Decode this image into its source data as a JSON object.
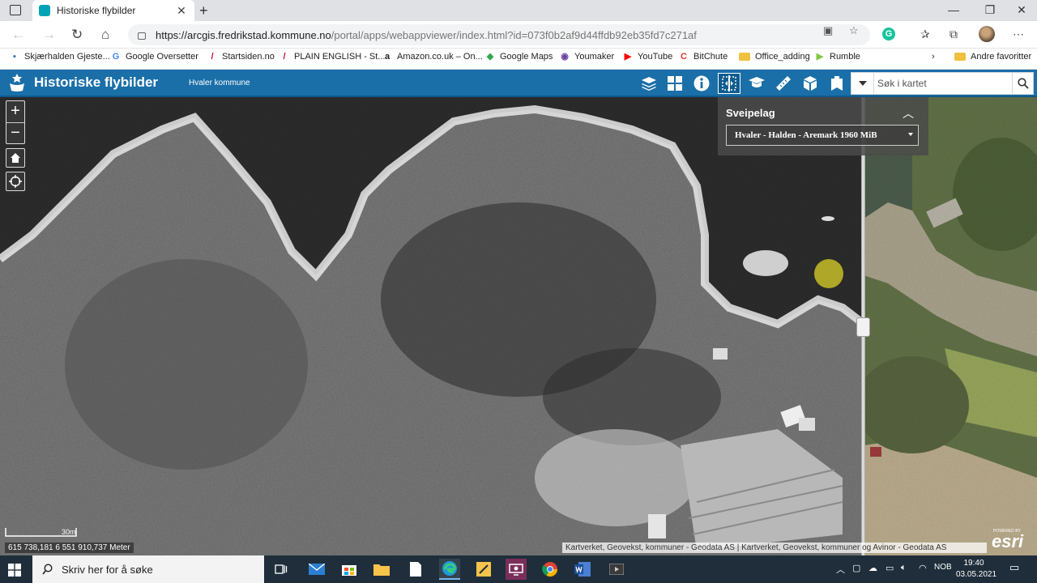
{
  "browser": {
    "tab_title": "Historiske flybilder",
    "url_host": "https://arcgis.fredrikstad.kommune.no",
    "url_path": "/portal/apps/webappviewer/index.html?id=073f0b2af9d44ffdb92eb35fd7c271af",
    "bookmarks": [
      {
        "label": "Skjærhalden Gjeste...",
        "icon": "bookmark-icon",
        "color": "#2a6db5"
      },
      {
        "label": "Google Oversetter",
        "icon": "translate-icon",
        "color": "#4285f4"
      },
      {
        "label": "Startsiden.no",
        "icon": "slash-icon",
        "color": "#c8102e"
      },
      {
        "label": "PLAIN ENGLISH - St...",
        "icon": "slash-icon",
        "color": "#c8102e"
      },
      {
        "label": "Amazon.co.uk – On...",
        "icon": "amazon-icon",
        "color": "#222222"
      },
      {
        "label": "Google Maps",
        "icon": "map-pin-icon",
        "color": "#34a853"
      },
      {
        "label": "Youmaker",
        "icon": "youmaker-icon",
        "color": "#6b3fa0"
      },
      {
        "label": "YouTube",
        "icon": "youtube-icon",
        "color": "#ff0000"
      },
      {
        "label": "BitChute",
        "icon": "bitchute-icon",
        "color": "#e8331c"
      },
      {
        "label": "Office_adding",
        "icon": "folder-icon",
        "color": "#f0c040"
      },
      {
        "label": "Rumble",
        "icon": "rumble-icon",
        "color": "#85c742"
      }
    ],
    "other_favorites": "Andre favoritter"
  },
  "app": {
    "title": "Historiske flybilder",
    "subtitle": "Hvaler kommune",
    "header_color": "#1a6fa8",
    "widgets": [
      "layers-icon",
      "basemap-gallery-icon",
      "info-icon",
      "swipe-icon",
      "education-icon",
      "measure-icon",
      "3d-box-icon",
      "bookmark-widget-icon"
    ],
    "search_placeholder": "Søk i kartet"
  },
  "map": {
    "swipe_panel": {
      "title": "Sveipelag",
      "selected_layer": "Hvaler - Halden - Aremark 1960 MiB"
    },
    "scale_label": "30m",
    "coordinates": "615 738,181 6 551 910,737 Meter",
    "attribution": "Kartverket, Geovekst, kommuner - Geodata AS | Kartverket, Geovekst, kommuner og Avinor - Geodata AS",
    "esri_logo": "esri",
    "powered_by": "POWERED BY"
  },
  "taskbar": {
    "search_placeholder": "Skriv her for å søke",
    "language": "NOB",
    "time": "19:40",
    "date": "03.05.2021"
  }
}
